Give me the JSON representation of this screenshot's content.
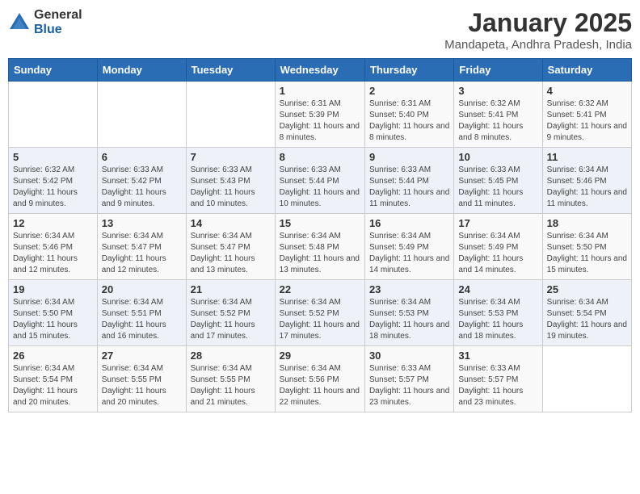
{
  "logo": {
    "general": "General",
    "blue": "Blue"
  },
  "title": "January 2025",
  "location": "Mandapeta, Andhra Pradesh, India",
  "weekdays": [
    "Sunday",
    "Monday",
    "Tuesday",
    "Wednesday",
    "Thursday",
    "Friday",
    "Saturday"
  ],
  "weeks": [
    [
      {
        "day": "",
        "sunrise": "",
        "sunset": "",
        "daylight": ""
      },
      {
        "day": "",
        "sunrise": "",
        "sunset": "",
        "daylight": ""
      },
      {
        "day": "",
        "sunrise": "",
        "sunset": "",
        "daylight": ""
      },
      {
        "day": "1",
        "sunrise": "Sunrise: 6:31 AM",
        "sunset": "Sunset: 5:39 PM",
        "daylight": "Daylight: 11 hours and 8 minutes."
      },
      {
        "day": "2",
        "sunrise": "Sunrise: 6:31 AM",
        "sunset": "Sunset: 5:40 PM",
        "daylight": "Daylight: 11 hours and 8 minutes."
      },
      {
        "day": "3",
        "sunrise": "Sunrise: 6:32 AM",
        "sunset": "Sunset: 5:41 PM",
        "daylight": "Daylight: 11 hours and 8 minutes."
      },
      {
        "day": "4",
        "sunrise": "Sunrise: 6:32 AM",
        "sunset": "Sunset: 5:41 PM",
        "daylight": "Daylight: 11 hours and 9 minutes."
      }
    ],
    [
      {
        "day": "5",
        "sunrise": "Sunrise: 6:32 AM",
        "sunset": "Sunset: 5:42 PM",
        "daylight": "Daylight: 11 hours and 9 minutes."
      },
      {
        "day": "6",
        "sunrise": "Sunrise: 6:33 AM",
        "sunset": "Sunset: 5:42 PM",
        "daylight": "Daylight: 11 hours and 9 minutes."
      },
      {
        "day": "7",
        "sunrise": "Sunrise: 6:33 AM",
        "sunset": "Sunset: 5:43 PM",
        "daylight": "Daylight: 11 hours and 10 minutes."
      },
      {
        "day": "8",
        "sunrise": "Sunrise: 6:33 AM",
        "sunset": "Sunset: 5:44 PM",
        "daylight": "Daylight: 11 hours and 10 minutes."
      },
      {
        "day": "9",
        "sunrise": "Sunrise: 6:33 AM",
        "sunset": "Sunset: 5:44 PM",
        "daylight": "Daylight: 11 hours and 11 minutes."
      },
      {
        "day": "10",
        "sunrise": "Sunrise: 6:33 AM",
        "sunset": "Sunset: 5:45 PM",
        "daylight": "Daylight: 11 hours and 11 minutes."
      },
      {
        "day": "11",
        "sunrise": "Sunrise: 6:34 AM",
        "sunset": "Sunset: 5:46 PM",
        "daylight": "Daylight: 11 hours and 11 minutes."
      }
    ],
    [
      {
        "day": "12",
        "sunrise": "Sunrise: 6:34 AM",
        "sunset": "Sunset: 5:46 PM",
        "daylight": "Daylight: 11 hours and 12 minutes."
      },
      {
        "day": "13",
        "sunrise": "Sunrise: 6:34 AM",
        "sunset": "Sunset: 5:47 PM",
        "daylight": "Daylight: 11 hours and 12 minutes."
      },
      {
        "day": "14",
        "sunrise": "Sunrise: 6:34 AM",
        "sunset": "Sunset: 5:47 PM",
        "daylight": "Daylight: 11 hours and 13 minutes."
      },
      {
        "day": "15",
        "sunrise": "Sunrise: 6:34 AM",
        "sunset": "Sunset: 5:48 PM",
        "daylight": "Daylight: 11 hours and 13 minutes."
      },
      {
        "day": "16",
        "sunrise": "Sunrise: 6:34 AM",
        "sunset": "Sunset: 5:49 PM",
        "daylight": "Daylight: 11 hours and 14 minutes."
      },
      {
        "day": "17",
        "sunrise": "Sunrise: 6:34 AM",
        "sunset": "Sunset: 5:49 PM",
        "daylight": "Daylight: 11 hours and 14 minutes."
      },
      {
        "day": "18",
        "sunrise": "Sunrise: 6:34 AM",
        "sunset": "Sunset: 5:50 PM",
        "daylight": "Daylight: 11 hours and 15 minutes."
      }
    ],
    [
      {
        "day": "19",
        "sunrise": "Sunrise: 6:34 AM",
        "sunset": "Sunset: 5:50 PM",
        "daylight": "Daylight: 11 hours and 15 minutes."
      },
      {
        "day": "20",
        "sunrise": "Sunrise: 6:34 AM",
        "sunset": "Sunset: 5:51 PM",
        "daylight": "Daylight: 11 hours and 16 minutes."
      },
      {
        "day": "21",
        "sunrise": "Sunrise: 6:34 AM",
        "sunset": "Sunset: 5:52 PM",
        "daylight": "Daylight: 11 hours and 17 minutes."
      },
      {
        "day": "22",
        "sunrise": "Sunrise: 6:34 AM",
        "sunset": "Sunset: 5:52 PM",
        "daylight": "Daylight: 11 hours and 17 minutes."
      },
      {
        "day": "23",
        "sunrise": "Sunrise: 6:34 AM",
        "sunset": "Sunset: 5:53 PM",
        "daylight": "Daylight: 11 hours and 18 minutes."
      },
      {
        "day": "24",
        "sunrise": "Sunrise: 6:34 AM",
        "sunset": "Sunset: 5:53 PM",
        "daylight": "Daylight: 11 hours and 18 minutes."
      },
      {
        "day": "25",
        "sunrise": "Sunrise: 6:34 AM",
        "sunset": "Sunset: 5:54 PM",
        "daylight": "Daylight: 11 hours and 19 minutes."
      }
    ],
    [
      {
        "day": "26",
        "sunrise": "Sunrise: 6:34 AM",
        "sunset": "Sunset: 5:54 PM",
        "daylight": "Daylight: 11 hours and 20 minutes."
      },
      {
        "day": "27",
        "sunrise": "Sunrise: 6:34 AM",
        "sunset": "Sunset: 5:55 PM",
        "daylight": "Daylight: 11 hours and 20 minutes."
      },
      {
        "day": "28",
        "sunrise": "Sunrise: 6:34 AM",
        "sunset": "Sunset: 5:55 PM",
        "daylight": "Daylight: 11 hours and 21 minutes."
      },
      {
        "day": "29",
        "sunrise": "Sunrise: 6:34 AM",
        "sunset": "Sunset: 5:56 PM",
        "daylight": "Daylight: 11 hours and 22 minutes."
      },
      {
        "day": "30",
        "sunrise": "Sunrise: 6:33 AM",
        "sunset": "Sunset: 5:57 PM",
        "daylight": "Daylight: 11 hours and 23 minutes."
      },
      {
        "day": "31",
        "sunrise": "Sunrise: 6:33 AM",
        "sunset": "Sunset: 5:57 PM",
        "daylight": "Daylight: 11 hours and 23 minutes."
      },
      {
        "day": "",
        "sunrise": "",
        "sunset": "",
        "daylight": ""
      }
    ]
  ]
}
